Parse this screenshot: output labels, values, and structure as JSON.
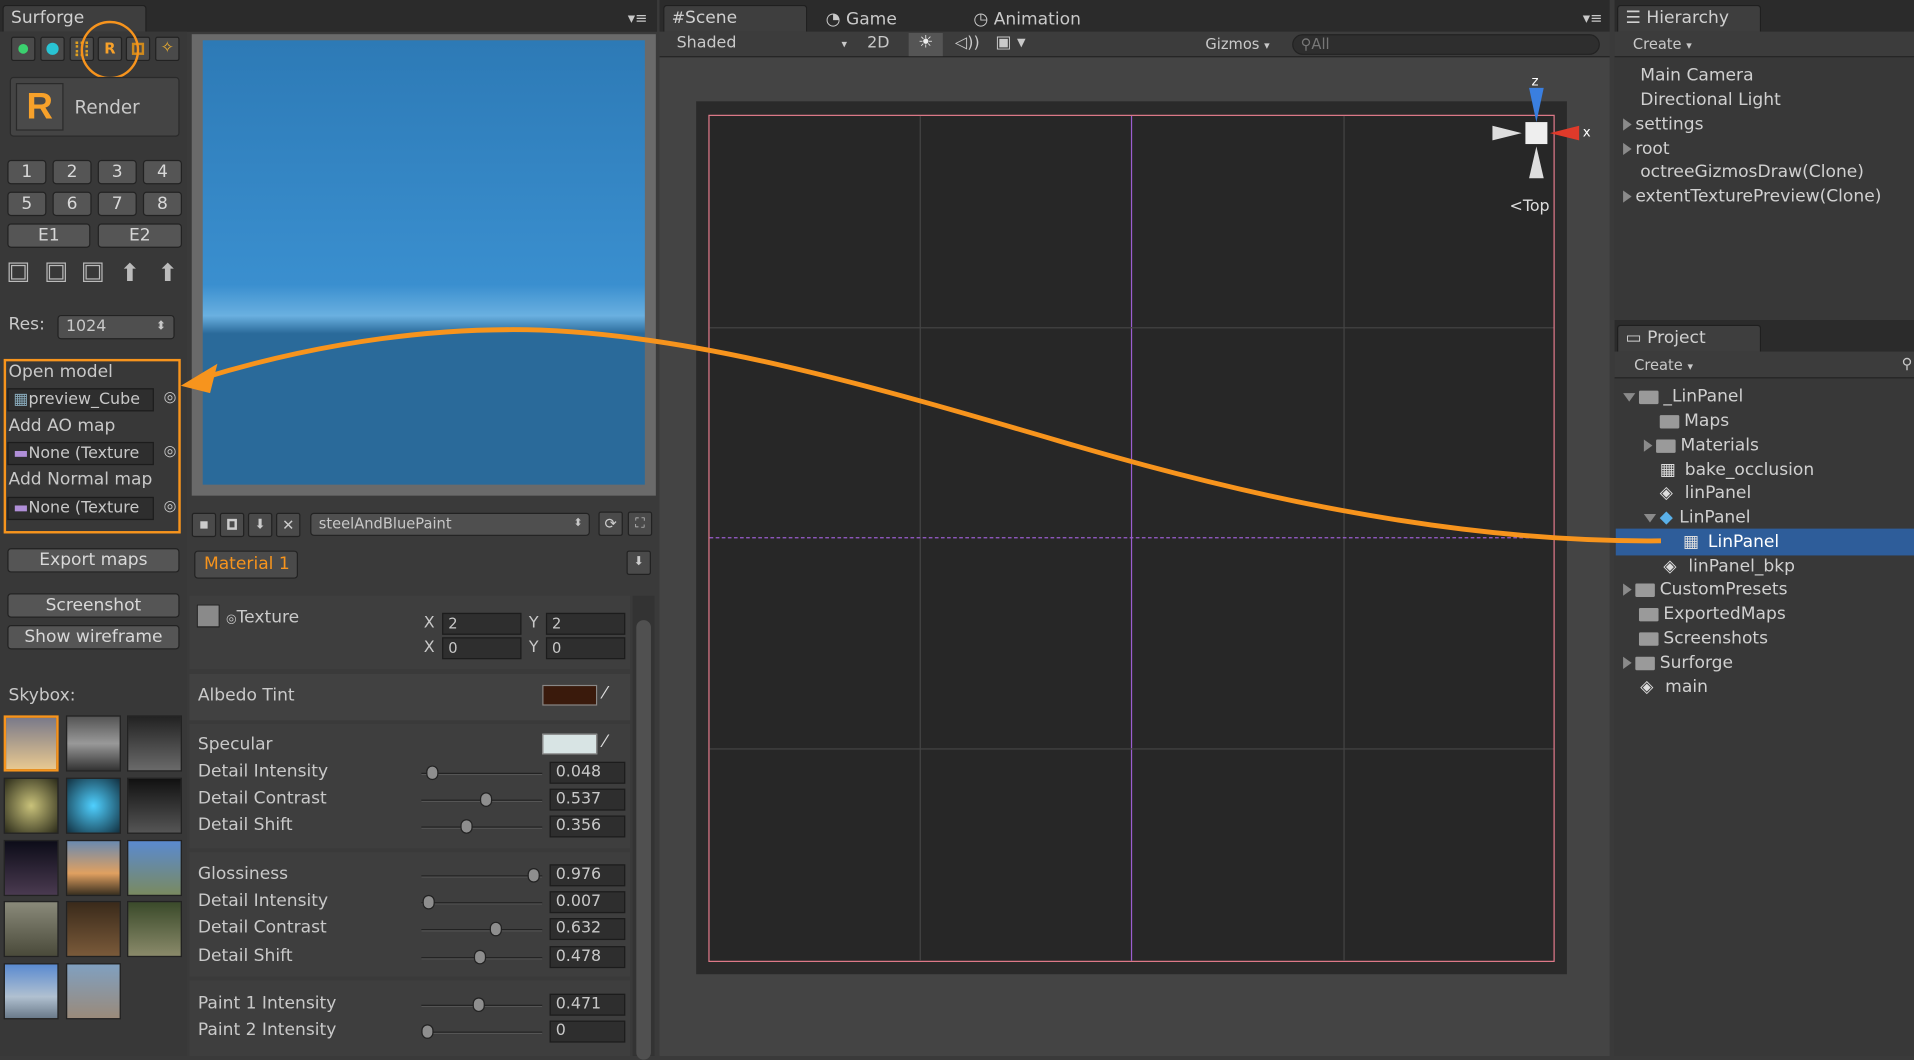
{
  "surforge": {
    "tab": "Surforge",
    "render_label": "Render",
    "render_icon_letter": "R",
    "top_icon_letter": "R",
    "numbers": [
      "1",
      "2",
      "3",
      "4",
      "5",
      "6",
      "7",
      "8"
    ],
    "e_buttons": [
      "E1",
      "E2"
    ],
    "res_label": "Res:",
    "res_value": "1024",
    "open_model": "Open model",
    "preview_field": "preview_Cube",
    "add_ao": "Add AO map",
    "ao_field": "None (Texture",
    "add_normal": "Add Normal map",
    "normal_field": "None (Texture",
    "export_maps": "Export maps",
    "screenshot": "Screenshot",
    "show_wireframe": "Show wireframe",
    "skybox_label": "Skybox:",
    "preset_dropdown": "steelAndBluePaint",
    "material_label": "Material 1",
    "texture_label": "Texture",
    "tiling": {
      "x_label": "X",
      "x": "2",
      "y_label": "Y",
      "y": "2"
    },
    "offset": {
      "x_label": "X",
      "x": "0",
      "y_label": "Y",
      "y": "0"
    },
    "albedo_tint": "Albedo Tint",
    "specular": "Specular",
    "sliders": [
      {
        "label": "Detail Intensity",
        "value": "0.048",
        "fraction": 0.048
      },
      {
        "label": "Detail Contrast",
        "value": "0.537",
        "fraction": 0.537
      },
      {
        "label": "Detail Shift",
        "value": "0.356",
        "fraction": 0.356
      },
      {
        "label": "Glossiness",
        "value": "0.976",
        "fraction": 0.976
      },
      {
        "label": "Detail Intensity",
        "value": "0.007",
        "fraction": 0.007
      },
      {
        "label": "Detail Contrast",
        "value": "0.632",
        "fraction": 0.632
      },
      {
        "label": "Detail Shift",
        "value": "0.478",
        "fraction": 0.478
      },
      {
        "label": "Paint 1 Intensity",
        "value": "0.471",
        "fraction": 0.471
      },
      {
        "label": "Paint 2 Intensity",
        "value": "0",
        "fraction": 0.0
      }
    ],
    "colors": {
      "accent": "#f7941d",
      "albedo": "#3a1a0c",
      "specular": "#d8e4e4"
    }
  },
  "scene": {
    "tabs": [
      "Scene",
      "Game",
      "Animation"
    ],
    "shading": "Shaded",
    "mode_2d": "2D",
    "gizmos": "Gizmos",
    "search_placeholder": "All",
    "axis_z": "z",
    "axis_x": "x",
    "view_label": "Top"
  },
  "hierarchy": {
    "tab": "Hierarchy",
    "create": "Create",
    "items": [
      "Main Camera",
      "Directional Light",
      "settings",
      "root",
      "octreeGizmosDraw(Clone)",
      "extentTexturePreview(Clone)"
    ]
  },
  "project": {
    "tab": "Project",
    "create": "Create",
    "items": [
      "_LinPanel",
      "Maps",
      "Materials",
      "bake_occlusion",
      "linPanel",
      "LinPanel",
      "LinPanel",
      "linPanel_bkp",
      "CustomPresets",
      "ExportedMaps",
      "Screenshots",
      "Surforge",
      "main"
    ]
  }
}
